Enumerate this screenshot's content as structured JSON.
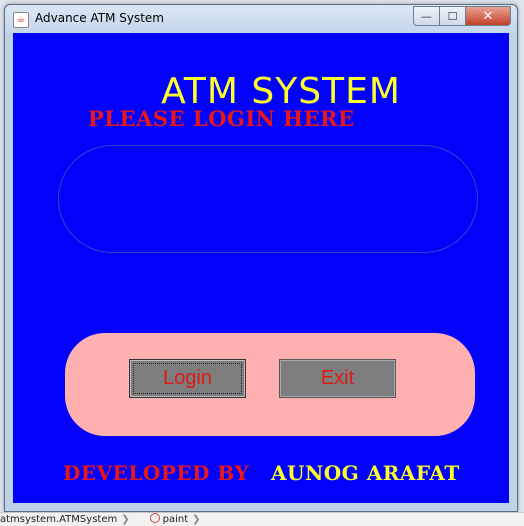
{
  "window": {
    "title": "Advance ATM System",
    "minimize_glyph": "—",
    "maximize_glyph": "☐",
    "close_glyph": "✕"
  },
  "app": {
    "heading": "ATM SYSTEM",
    "login_prompt": "PLEASE LOGIN HERE",
    "login_button": "Login",
    "exit_button": "Exit",
    "developed_by_label": "DEVELOPED BY",
    "developer_name": "AUNOG ARAFAT"
  },
  "statusbar": {
    "item1": "atmsystem.ATMSystem",
    "separator": "❯",
    "item2": "paint"
  },
  "colors": {
    "content_bg": "#0202fb",
    "heading": "#ffff2a",
    "login_text": "#e8181a",
    "button_panel": "#ffb0b0",
    "button_bg": "#7d7d7d",
    "button_text": "#e01818"
  },
  "icons": {
    "app_icon": "java-cup-icon",
    "paint_icon": "circle-icon"
  }
}
